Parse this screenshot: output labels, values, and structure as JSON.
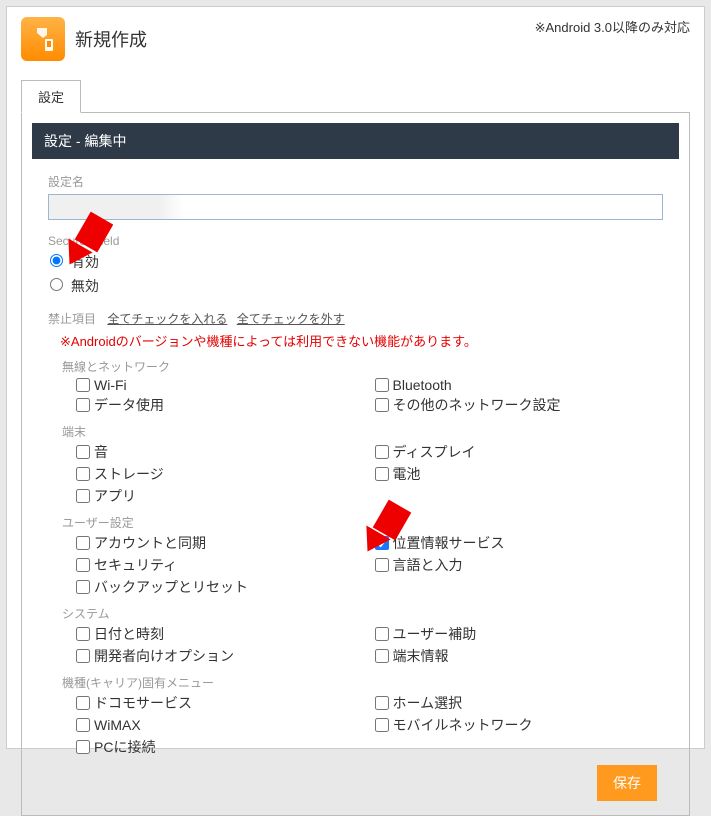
{
  "header": {
    "title": "新規作成",
    "compat_note": "※Android 3.0以降のみ対応"
  },
  "tab": {
    "label": "設定"
  },
  "panel": {
    "title": "設定 - 編集中",
    "name_label": "設定名",
    "name_value": "",
    "shield_label": "SecureShield",
    "shield_options": {
      "enabled": "有効",
      "disabled": "無効"
    },
    "shield_value": "enabled",
    "prohibit_label": "禁止項目",
    "check_all": "全てチェックを入れる",
    "uncheck_all": "全てチェックを外す",
    "warning": "※Androidのバージョンや機種によっては利用できない機能があります。",
    "groups": [
      {
        "label": "無線とネットワーク",
        "items": [
          {
            "label": "Wi-Fi",
            "checked": false
          },
          {
            "label": "Bluetooth",
            "checked": false
          },
          {
            "label": "データ使用",
            "checked": false
          },
          {
            "label": "その他のネットワーク設定",
            "checked": false
          }
        ]
      },
      {
        "label": "端末",
        "items": [
          {
            "label": "音",
            "checked": false
          },
          {
            "label": "ディスプレイ",
            "checked": false
          },
          {
            "label": "ストレージ",
            "checked": false
          },
          {
            "label": "電池",
            "checked": false
          },
          {
            "label": "アプリ",
            "checked": false
          }
        ]
      },
      {
        "label": "ユーザー設定",
        "items": [
          {
            "label": "アカウントと同期",
            "checked": false
          },
          {
            "label": "位置情報サービス",
            "checked": true
          },
          {
            "label": "セキュリティ",
            "checked": false
          },
          {
            "label": "言語と入力",
            "checked": false
          },
          {
            "label": "バックアップとリセット",
            "checked": false
          }
        ]
      },
      {
        "label": "システム",
        "items": [
          {
            "label": "日付と時刻",
            "checked": false
          },
          {
            "label": "ユーザー補助",
            "checked": false
          },
          {
            "label": "開発者向けオプション",
            "checked": false
          },
          {
            "label": "端末情報",
            "checked": false
          }
        ]
      },
      {
        "label": "機種(キャリア)固有メニュー",
        "items": [
          {
            "label": "ドコモサービス",
            "checked": false
          },
          {
            "label": "ホーム選択",
            "checked": false
          },
          {
            "label": "WiMAX",
            "checked": false
          },
          {
            "label": "モバイルネットワーク",
            "checked": false
          },
          {
            "label": "PCに接続",
            "checked": false
          }
        ]
      }
    ],
    "save_label": "保存"
  }
}
